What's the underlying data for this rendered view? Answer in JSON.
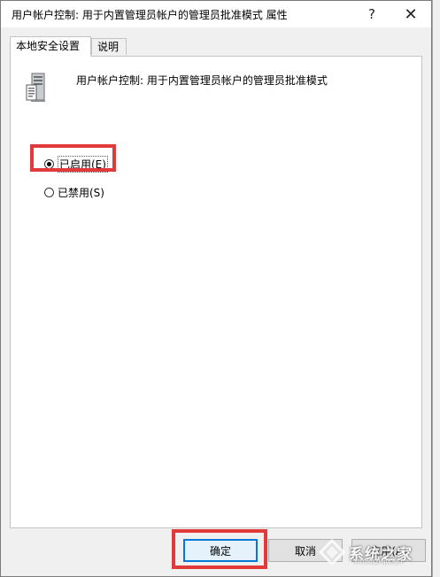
{
  "window": {
    "title": "用户帐户控制: 用于内置管理员帐户的管理员批准模式 属性",
    "help_glyph": "?",
    "close_glyph": "✕"
  },
  "tabs": [
    {
      "label": "本地安全设置",
      "active": true
    },
    {
      "label": "说明",
      "active": false
    }
  ],
  "policy": {
    "icon": "server-policy-icon",
    "name": "用户帐户控制: 用于内置管理员帐户的管理员批准模式"
  },
  "options": {
    "enabled": {
      "label": "已启用(E)",
      "checked": true
    },
    "disabled": {
      "label": "已禁用(S)",
      "checked": false
    }
  },
  "buttons": {
    "ok": "确定",
    "cancel": "取消",
    "apply": "应用(A)"
  },
  "colors": {
    "highlight": "#e03a3a",
    "focus_border": "#0078d7"
  },
  "watermark": {
    "text": "系统之家",
    "sub": "XITONGZHIJIA.NET"
  }
}
